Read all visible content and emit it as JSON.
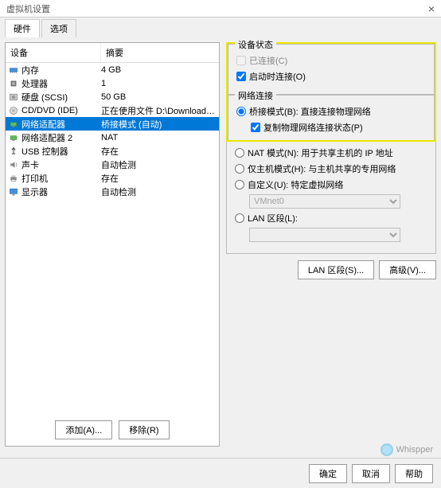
{
  "window": {
    "title": "虚拟机设置",
    "close": "×"
  },
  "tabs": {
    "hardware": "硬件",
    "options": "选项"
  },
  "columns": {
    "device": "设备",
    "summary": "摘要"
  },
  "devices": [
    {
      "name": "内存",
      "summary": "4 GB",
      "icon": "memory"
    },
    {
      "name": "处理器",
      "summary": "1",
      "icon": "cpu"
    },
    {
      "name": "硬盘 (SCSI)",
      "summary": "50 GB",
      "icon": "disk"
    },
    {
      "name": "CD/DVD (IDE)",
      "summary": "正在使用文件 D:\\Download\\Ku...",
      "icon": "cd"
    },
    {
      "name": "网络适配器",
      "summary": "桥接模式 (自动)",
      "icon": "net",
      "selected": true
    },
    {
      "name": "网络适配器 2",
      "summary": "NAT",
      "icon": "net"
    },
    {
      "name": "USB 控制器",
      "summary": "存在",
      "icon": "usb"
    },
    {
      "name": "声卡",
      "summary": "自动检测",
      "icon": "sound"
    },
    {
      "name": "打印机",
      "summary": "存在",
      "icon": "printer"
    },
    {
      "name": "显示器",
      "summary": "自动检测",
      "icon": "display"
    }
  ],
  "buttons": {
    "add": "添加(A)...",
    "remove": "移除(R)",
    "lan_segments": "LAN 区段(S)...",
    "advanced": "高级(V)...",
    "ok": "确定",
    "cancel": "取消",
    "help": "帮助"
  },
  "device_status": {
    "title": "设备状态",
    "connected": "已连接(C)",
    "connect_on_power": "启动时连接(O)"
  },
  "network": {
    "title": "网络连接",
    "bridged": "桥接模式(B): 直接连接物理网络",
    "replicate": "复制物理网络连接状态(P)",
    "nat": "NAT 模式(N): 用于共享主机的 IP 地址",
    "hostonly": "仅主机模式(H): 与主机共享的专用网络",
    "custom": "自定义(U): 特定虚拟网络",
    "custom_value": "VMnet0",
    "lan_segment": "LAN 区段(L):",
    "lan_value": ""
  },
  "watermark": "Whispper"
}
